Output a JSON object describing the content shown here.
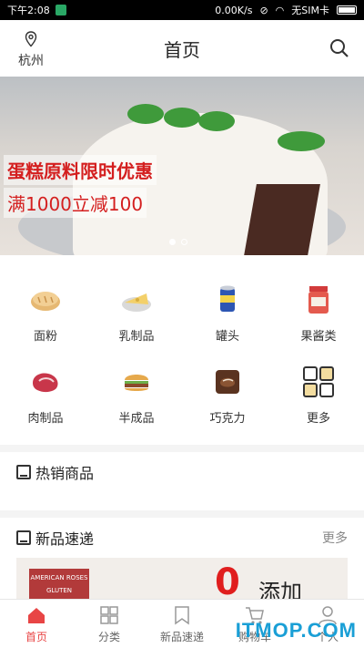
{
  "status_bar": {
    "time": "下午2:08",
    "net_speed": "0.00K/s",
    "sim": "无SIM卡"
  },
  "header": {
    "location": "杭州",
    "title": "首页",
    "location_icon": "location-pin-icon",
    "search_icon": "search-icon"
  },
  "banner": {
    "promo_line1": "蛋糕原料限时优惠",
    "promo_line2": "满1000立减100",
    "page_count": 2,
    "active_page": 1
  },
  "categories": [
    {
      "label": "面粉",
      "icon": "bread-icon"
    },
    {
      "label": "乳制品",
      "icon": "cheese-icon"
    },
    {
      "label": "罐头",
      "icon": "can-icon"
    },
    {
      "label": "果酱类",
      "icon": "jam-jar-icon"
    },
    {
      "label": "肉制品",
      "icon": "meat-icon"
    },
    {
      "label": "半成品",
      "icon": "burger-icon"
    },
    {
      "label": "巧克力",
      "icon": "chocolate-icon"
    },
    {
      "label": "更多",
      "icon": "grid-more-icon"
    }
  ],
  "sections": {
    "hot_title": "热销商品",
    "new_title": "新品速递",
    "new_more": "更多"
  },
  "new_banner": {
    "brand_text": "AMERICAN ROSES",
    "box_text": "GLUTEN",
    "zero": "0",
    "add_text": "添加"
  },
  "tabs": [
    {
      "label": "首页",
      "icon": "home-icon",
      "active": true
    },
    {
      "label": "分类",
      "icon": "category-grid-icon",
      "active": false
    },
    {
      "label": "新品速递",
      "icon": "bookmark-icon",
      "active": false
    },
    {
      "label": "购物车",
      "icon": "cart-icon",
      "active": false
    },
    {
      "label": "个人",
      "icon": "user-icon",
      "active": false
    }
  ],
  "watermark": "ITMOP.COM",
  "colors": {
    "accent": "#e84545",
    "promo_red": "#d41f1f"
  }
}
